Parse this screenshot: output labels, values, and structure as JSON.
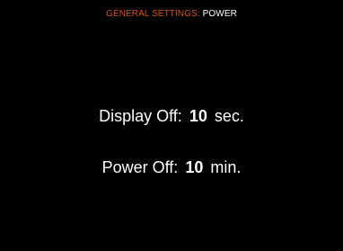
{
  "header": {
    "section": "GENERAL SETTINGS:",
    "page": "POWER"
  },
  "settings": [
    {
      "label": "Display Off:",
      "value": "10",
      "unit": "sec."
    },
    {
      "label": "Power Off:",
      "value": "10",
      "unit": "min."
    }
  ],
  "colors": {
    "background": "#000000",
    "header_section": "#d9541c",
    "text": "#ffffff"
  }
}
